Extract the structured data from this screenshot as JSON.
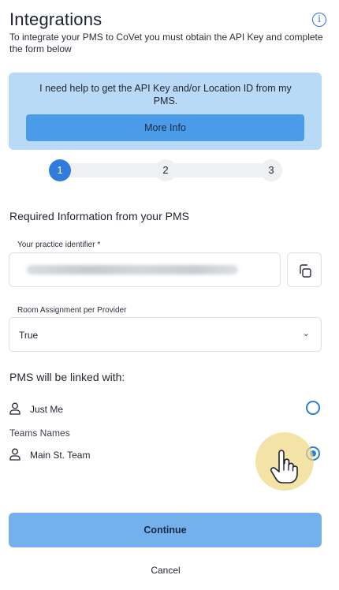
{
  "header": {
    "title": "Integrations",
    "info_icon": "info-icon",
    "subtitle": "To integrate your PMS to CoVet you must obtain the API Key and complete the form below"
  },
  "help": {
    "text": "I need help to get the API Key and/or Location ID from my PMS.",
    "button_label": "More Info"
  },
  "stepper": {
    "steps": [
      "1",
      "2",
      "3"
    ],
    "active_step": 1
  },
  "form": {
    "section_title": "Required Information from your PMS",
    "practice_id_label": "Your practice identifier *",
    "copy_icon": "copy-icon",
    "room_assignment_label": "Room Assignment per Provider",
    "room_assignment_value": "True",
    "select_icon": "chevron-down-icon"
  },
  "linking": {
    "title": "PMS will be linked with:",
    "just_me_label": "Just Me",
    "teams_label": "Teams Names",
    "teams": [
      {
        "label": "Main St. Team",
        "selected": true
      }
    ],
    "just_me_selected": false
  },
  "actions": {
    "continue_label": "Continue",
    "cancel_label": "Cancel"
  },
  "colors": {
    "accent": "#2f7bde",
    "help_bg": "#b8daf6",
    "continue_bg": "#74b1ec"
  }
}
